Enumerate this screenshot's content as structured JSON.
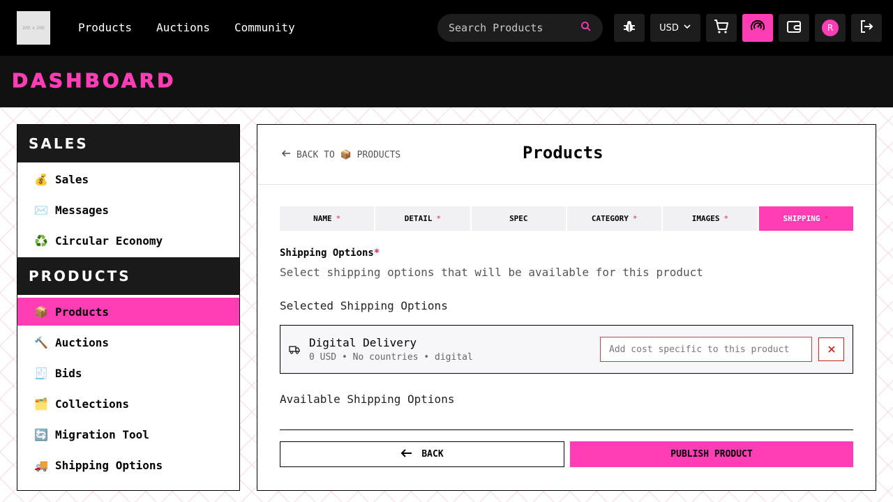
{
  "colors": {
    "accent": "#ff3eb5",
    "nav_bg": "#000000",
    "header_bg": "#111111",
    "required": "#e0245e"
  },
  "logo": {
    "placeholder_text": "200 × 200"
  },
  "nav": {
    "links": [
      "Products",
      "Auctions",
      "Community"
    ]
  },
  "search": {
    "placeholder": "Search Products",
    "icon": "search-icon"
  },
  "toolbar": {
    "currency": "USD",
    "avatar_initial": "R",
    "icons": [
      "bug-icon",
      "chevron-down-icon",
      "cart-icon",
      "dashboard-gauge-icon",
      "wallet-icon",
      "logout-icon"
    ]
  },
  "page_title": "DASHBOARD",
  "sidebar": {
    "sections": [
      {
        "title": "SALES",
        "items": [
          {
            "emoji": "💰",
            "label": "Sales"
          },
          {
            "emoji": "✉️",
            "label": "Messages"
          },
          {
            "emoji": "♻️",
            "label": "Circular Economy"
          }
        ]
      },
      {
        "title": "PRODUCTS",
        "items": [
          {
            "emoji": "📦",
            "label": "Products",
            "active": true
          },
          {
            "emoji": "🔨",
            "label": "Auctions"
          },
          {
            "emoji": "🧾",
            "label": "Bids"
          },
          {
            "emoji": "🗂️",
            "label": "Collections"
          },
          {
            "emoji": "🔄",
            "label": "Migration Tool"
          },
          {
            "emoji": "🚚",
            "label": "Shipping Options"
          }
        ]
      }
    ]
  },
  "panel": {
    "back_link": "Back to 📦 Products",
    "title": "Products",
    "tabs": [
      {
        "label": "Name",
        "required": true
      },
      {
        "label": "Detail",
        "required": true
      },
      {
        "label": "Spec",
        "required": false
      },
      {
        "label": "Category",
        "required": true
      },
      {
        "label": "Images",
        "required": true
      },
      {
        "label": "Shipping",
        "required": true,
        "active": true
      }
    ],
    "field_label": "Shipping Options",
    "required_mark": "*",
    "field_help": "Select shipping options that will be available for this product",
    "selected_heading": "Selected Shipping Options",
    "selected_option": {
      "name": "Digital Delivery",
      "meta": "0 USD • No countries • digital",
      "cost_placeholder": "Add cost specific to this product"
    },
    "available_heading": "Available Shipping Options",
    "back_button": "Back",
    "publish_button": "Publish Product"
  }
}
